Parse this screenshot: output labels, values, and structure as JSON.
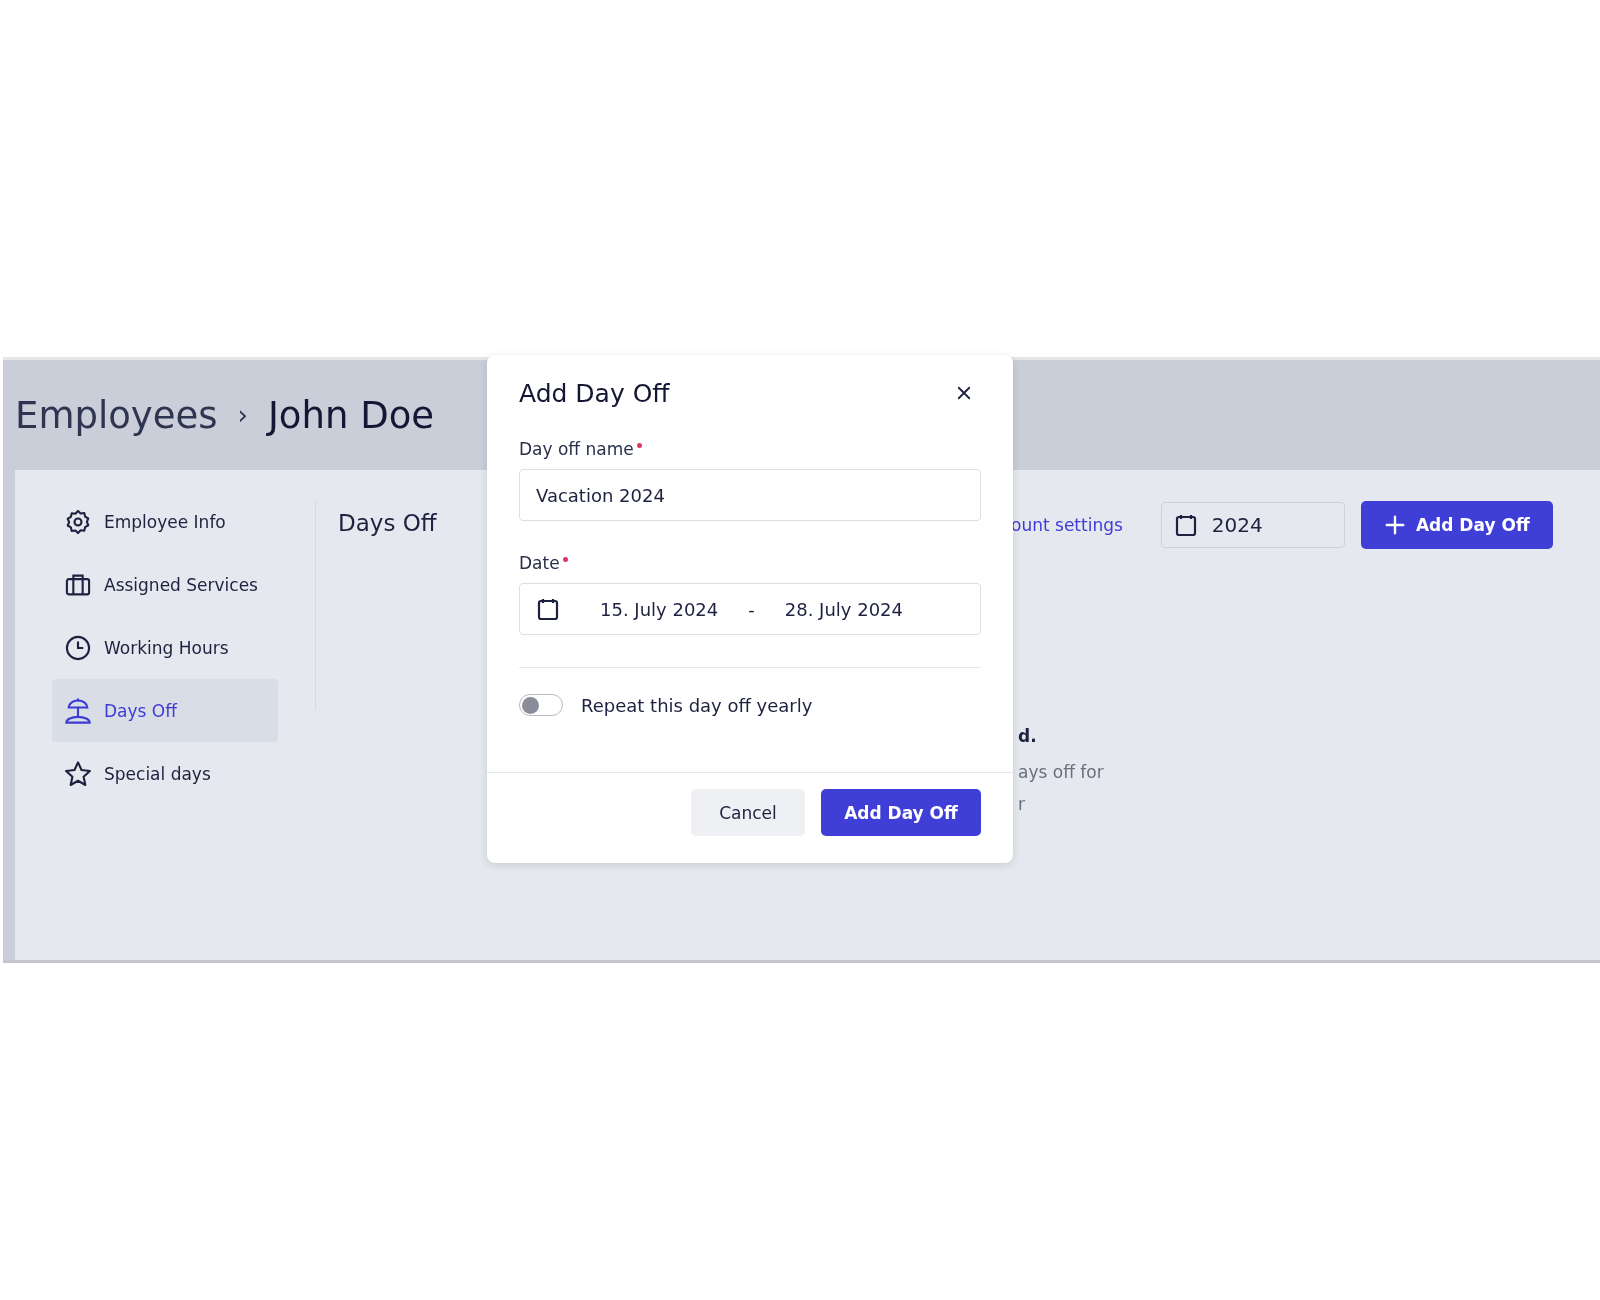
{
  "breadcrumb": {
    "parent": "Employees",
    "separator": "›",
    "current": "John Doe"
  },
  "sidebar": {
    "items": [
      {
        "label": "Employee Info",
        "selected": false
      },
      {
        "label": "Assigned Services",
        "selected": false
      },
      {
        "label": "Working Hours",
        "selected": false
      },
      {
        "label": "Days Off",
        "selected": true
      },
      {
        "label": "Special days",
        "selected": false
      }
    ]
  },
  "page": {
    "title": "Days Off",
    "settings_link": "ount settings",
    "year": "2024",
    "add_button": "Add Day Off",
    "empty_title": "d.",
    "empty_lines": [
      "ays off for",
      "r"
    ]
  },
  "dialog": {
    "title": "Add Day Off",
    "name_label": "Day off name",
    "name_required": true,
    "name_value": "Vacation 2024",
    "date_label": "Date",
    "date_required": true,
    "date_from": "15. July 2024",
    "date_separator": "-",
    "date_to": "28. July 2024",
    "repeat_label": "Repeat this day off yearly",
    "repeat_on": false,
    "cancel": "Cancel",
    "confirm": "Add Day Off"
  }
}
